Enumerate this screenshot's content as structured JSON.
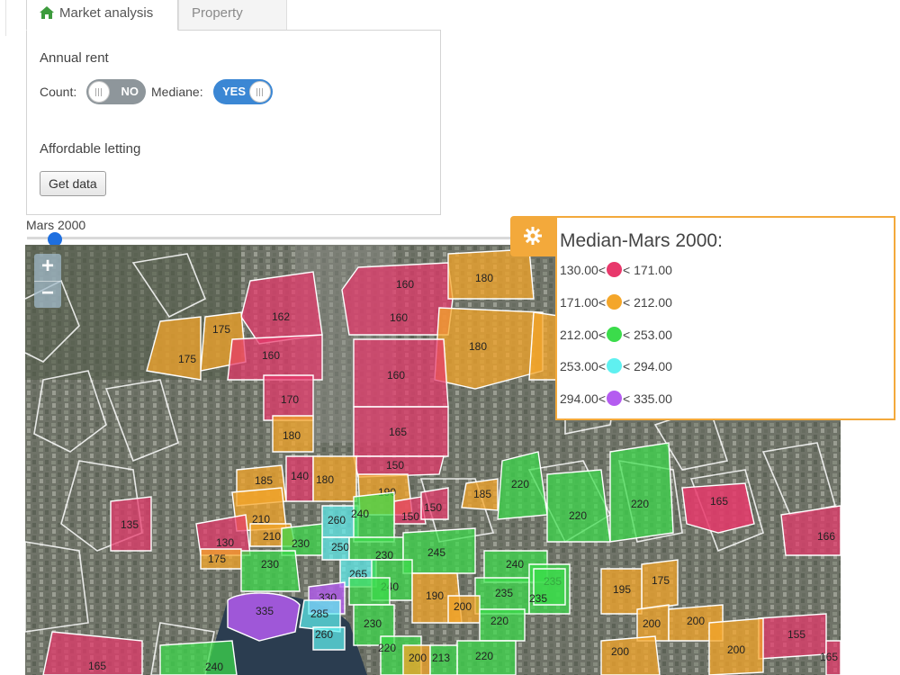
{
  "tabs": [
    {
      "label": "Market analysis",
      "icon": "home-icon",
      "active": true
    },
    {
      "label": "Property",
      "active": false
    }
  ],
  "panel": {
    "annual_rent_label": "Annual rent",
    "count_label": "Count:",
    "count_toggle": "NO",
    "mediane_label": "Mediane:",
    "mediane_toggle": "YES",
    "affordable_label": "Affordable letting",
    "get_data_label": "Get data"
  },
  "slider": {
    "label": "Mars 2000",
    "position": 0
  },
  "map": {
    "zoom_in": "+",
    "zoom_out": "−",
    "region_labels": [
      "160",
      "180",
      "162",
      "175",
      "160",
      "160",
      "175",
      "180",
      "160",
      "170",
      "180",
      "165",
      "150",
      "140",
      "180",
      "185",
      "190",
      "220",
      "165",
      "185",
      "210",
      "150",
      "150",
      "135",
      "260",
      "240",
      "130",
      "210",
      "230",
      "250",
      "230",
      "245",
      "220",
      "220",
      "166",
      "175",
      "230",
      "265",
      "240",
      "235",
      "235",
      "190",
      "175",
      "330",
      "240",
      "235",
      "195",
      "335",
      "285",
      "200",
      "230",
      "220",
      "200",
      "200",
      "260",
      "220",
      "155",
      "220",
      "200",
      "213",
      "200",
      "200",
      "165",
      "240",
      "165"
    ]
  },
  "legend": {
    "title": "Median-Mars 2000:",
    "items": [
      {
        "range_from": "130.00<",
        "range_to": "< 171.00",
        "color": "#e8386b"
      },
      {
        "range_from": "171.00<",
        "range_to": "< 212.00",
        "color": "#f4a62a"
      },
      {
        "range_from": "212.00<",
        "range_to": "< 253.00",
        "color": "#3bdc4b"
      },
      {
        "range_from": "253.00<",
        "range_to": "< 294.00",
        "color": "#5ff0f0"
      },
      {
        "range_from": "294.00<",
        "range_to": "< 335.00",
        "color": "#b45cf0"
      }
    ]
  }
}
